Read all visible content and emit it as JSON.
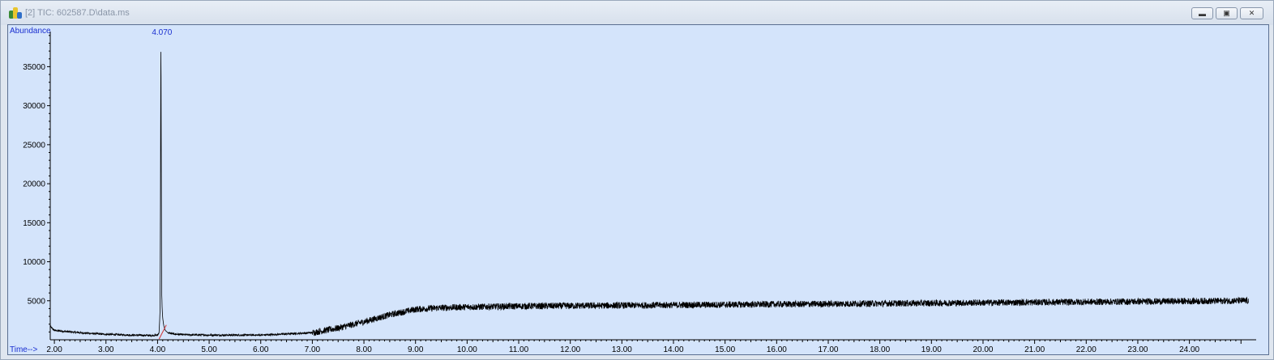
{
  "window": {
    "title": "[2] TIC: 602587.D\\data.ms",
    "controls": [
      "minimize",
      "restore",
      "close"
    ]
  },
  "colors": {
    "plot_background": "#d4e4fb",
    "trace": "#000000",
    "axis_label": "#1a2fd0",
    "peak_label": "#1a2fd0",
    "baseline_marker": "#d03030"
  },
  "chart_data": {
    "type": "line",
    "title": "",
    "xlabel": "Time-->",
    "ylabel": "Abundance",
    "xlim": [
      1.92,
      25.2
    ],
    "ylim": [
      0,
      39500
    ],
    "x_ticks": [
      "2.00",
      "3.00",
      "4.00",
      "5.00",
      "6.00",
      "7.00",
      "8.00",
      "9.00",
      "10.00",
      "11.00",
      "12.00",
      "13.00",
      "14.00",
      "15.00",
      "16.00",
      "17.00",
      "18.00",
      "19.00",
      "20.00",
      "21.00",
      "22.00",
      "23.00",
      "24.00"
    ],
    "y_ticks": [
      "5000",
      "10000",
      "15000",
      "20000",
      "25000",
      "30000",
      "35000"
    ],
    "peak_labels": [
      {
        "time": 4.07,
        "label": "4.070"
      }
    ],
    "series": [
      {
        "x": [
          1.92,
          2.0,
          2.5,
          3.0,
          3.5,
          3.9,
          4.0,
          4.03,
          4.05,
          4.06,
          4.065,
          4.07,
          4.075,
          4.08,
          4.09,
          4.1,
          4.12,
          4.15,
          4.2,
          4.3,
          4.5,
          5.0,
          6.0,
          7.0,
          7.5,
          8.0,
          8.5,
          9.0,
          9.5,
          10.0,
          11.0,
          12.0,
          13.0,
          14.0,
          15.0,
          16.0,
          17.0,
          18.0,
          19.0,
          20.0,
          21.0,
          22.0,
          23.0,
          24.0,
          25.0,
          25.15
        ],
        "y": [
          1700,
          1200,
          900,
          700,
          600,
          550,
          600,
          900,
          4000,
          26500,
          39500,
          30000,
          12000,
          6000,
          3800,
          2800,
          1800,
          1200,
          900,
          750,
          650,
          600,
          600,
          900,
          1500,
          2300,
          3200,
          3900,
          4100,
          4200,
          4300,
          4350,
          4400,
          4450,
          4500,
          4550,
          4600,
          4650,
          4700,
          4750,
          4800,
          4850,
          4900,
          4950,
          5000,
          5000
        ]
      }
    ]
  }
}
